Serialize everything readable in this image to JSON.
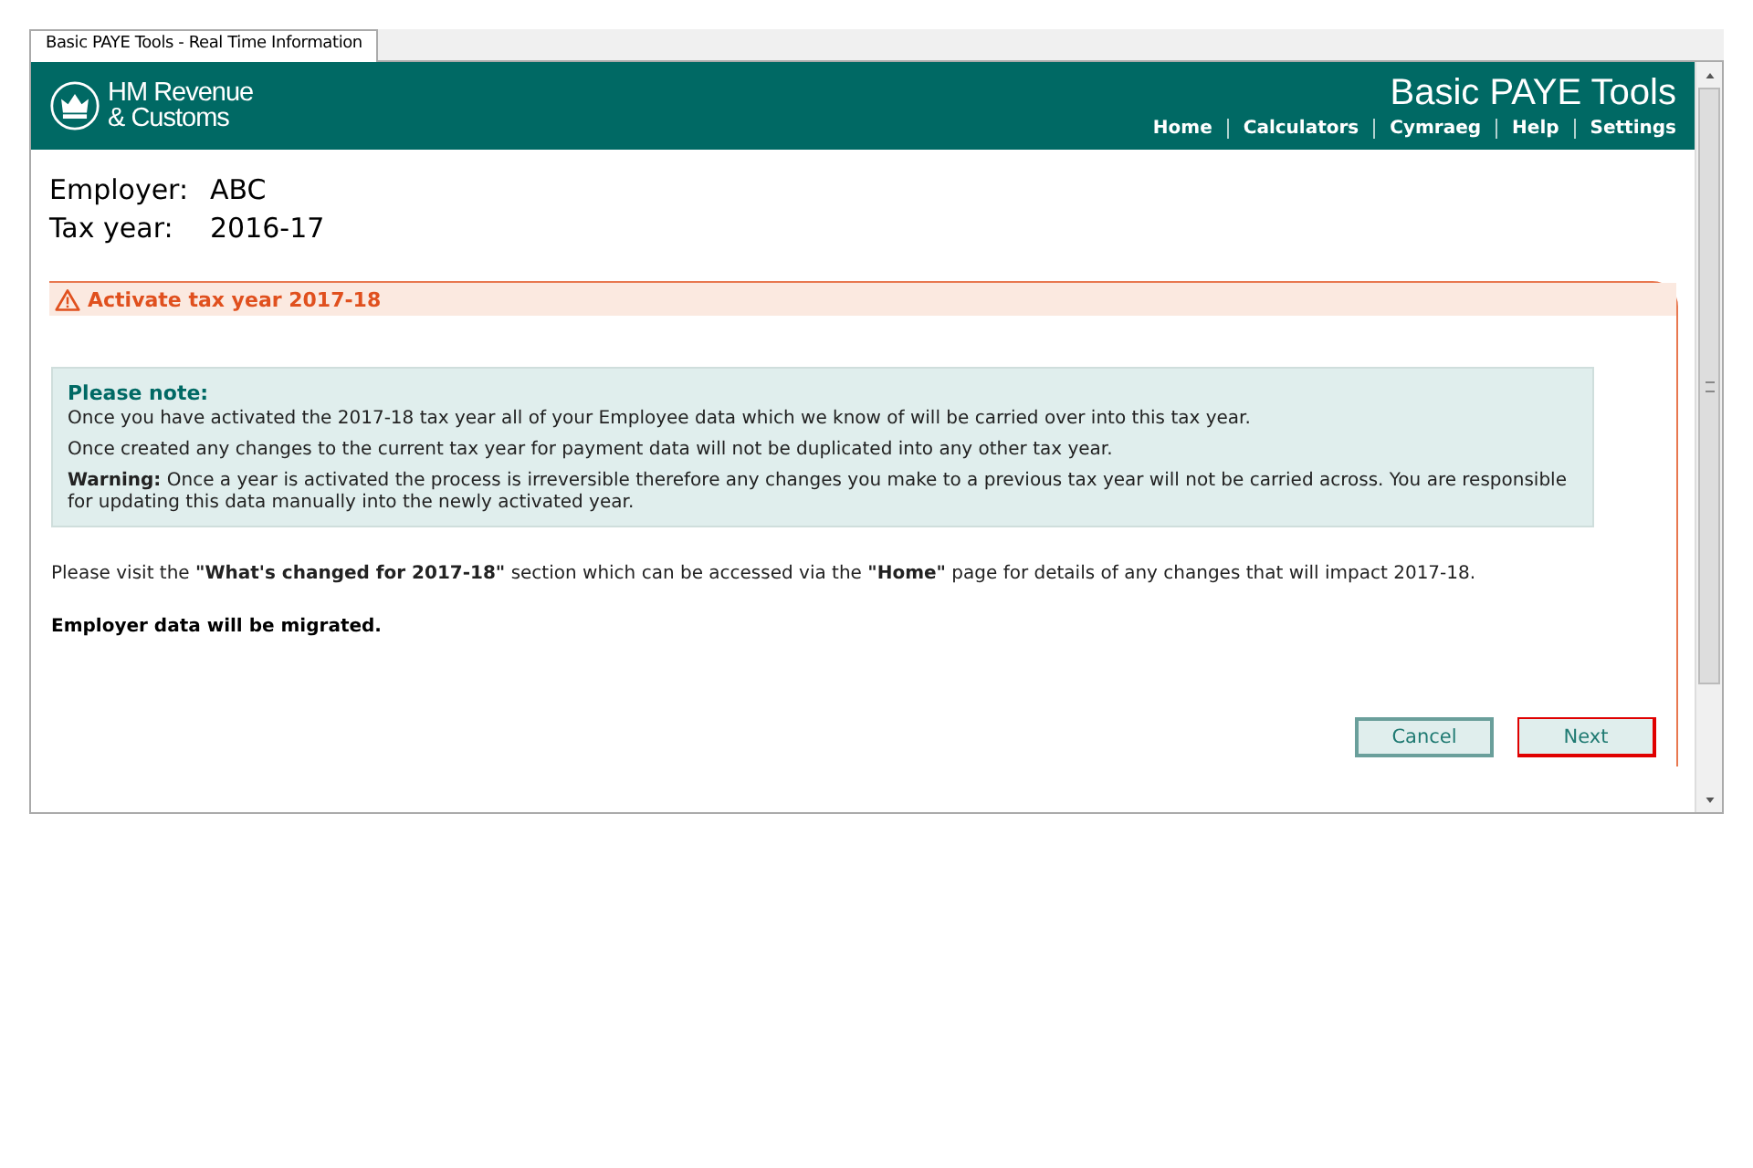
{
  "window": {
    "tab_title": "Basic PAYE Tools - Real Time Information"
  },
  "header": {
    "logo_line_1": "HM Revenue",
    "logo_line_2": "& Customs",
    "app_title": "Basic PAYE Tools",
    "nav": [
      {
        "label": "Home"
      },
      {
        "label": "Calculators"
      },
      {
        "label": "Cymraeg"
      },
      {
        "label": "Help"
      },
      {
        "label": "Settings"
      }
    ]
  },
  "details": [
    {
      "label": "Employer:",
      "value": "ABC"
    },
    {
      "label": "Tax year:",
      "value": "2016-17"
    }
  ],
  "panel": {
    "title": "Activate tax year 2017-18",
    "note": {
      "heading": "Please note:",
      "paragraphs": [
        "Once you have activated the 2017-18 tax year all of your Employee data which we know of will be carried over into this tax year.",
        "Once created any changes to the current tax year for payment data will not be duplicated into any other tax year.",
        "**Warning:** Once a year is activated the process is irreversible therefore any changes you make to a previous tax year will not be carried across. You are responsible for updating this data manually into the newly activated year."
      ]
    },
    "info": "Please visit the **\"What's changed for 2017-18\"** section which can be accessed via the **\"Home\"** page for details of any changes that will impact 2017-18.",
    "migration": "Employer data will be migrated.",
    "buttons": [
      {
        "label": "Cancel",
        "focused": false
      },
      {
        "label": "Next",
        "focused": true
      }
    ]
  }
}
